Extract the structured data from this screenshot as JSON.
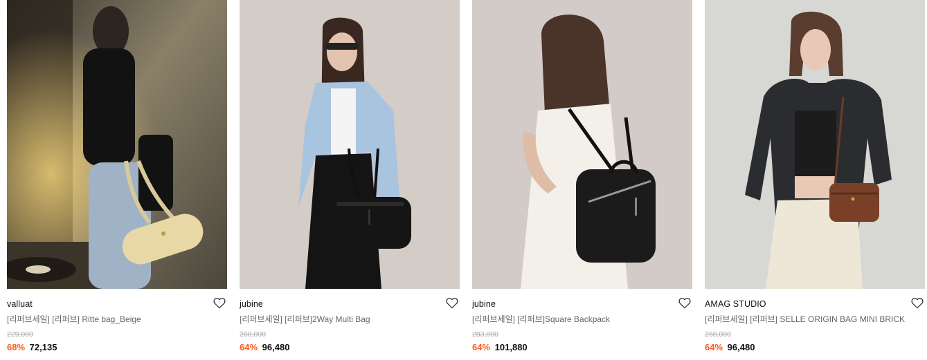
{
  "products": [
    {
      "brand": "valluat",
      "title": "[리퍼브세일] [리퍼브] Ritte bag_Beige",
      "original_price": "229,000",
      "discount": "68%",
      "sale_price": "72,135",
      "image_subject": "model-with-beige-bag"
    },
    {
      "brand": "jubine",
      "title": "[리퍼브세일] [리퍼브]2Way Multi Bag",
      "original_price": "268,000",
      "discount": "64%",
      "sale_price": "96,480",
      "image_subject": "model-with-black-bag"
    },
    {
      "brand": "jubine",
      "title": "[리퍼브세일] [리퍼브]Square Backpack",
      "original_price": "283,000",
      "discount": "64%",
      "sale_price": "101,880",
      "image_subject": "model-with-black-backpack"
    },
    {
      "brand": "AMAG STUDIO",
      "title": "[리퍼브세일] [리퍼브] SELLE ORIGIN BAG MINI BRICK",
      "original_price": "268,000",
      "discount": "64%",
      "sale_price": "96,480",
      "image_subject": "model-with-brown-bag"
    }
  ],
  "icons": {
    "wishlist": "heart-outline-icon"
  },
  "colors": {
    "discount": "#ff5a1f",
    "price": "#111111",
    "original_price": "#aaaaaa",
    "title": "#666666"
  }
}
